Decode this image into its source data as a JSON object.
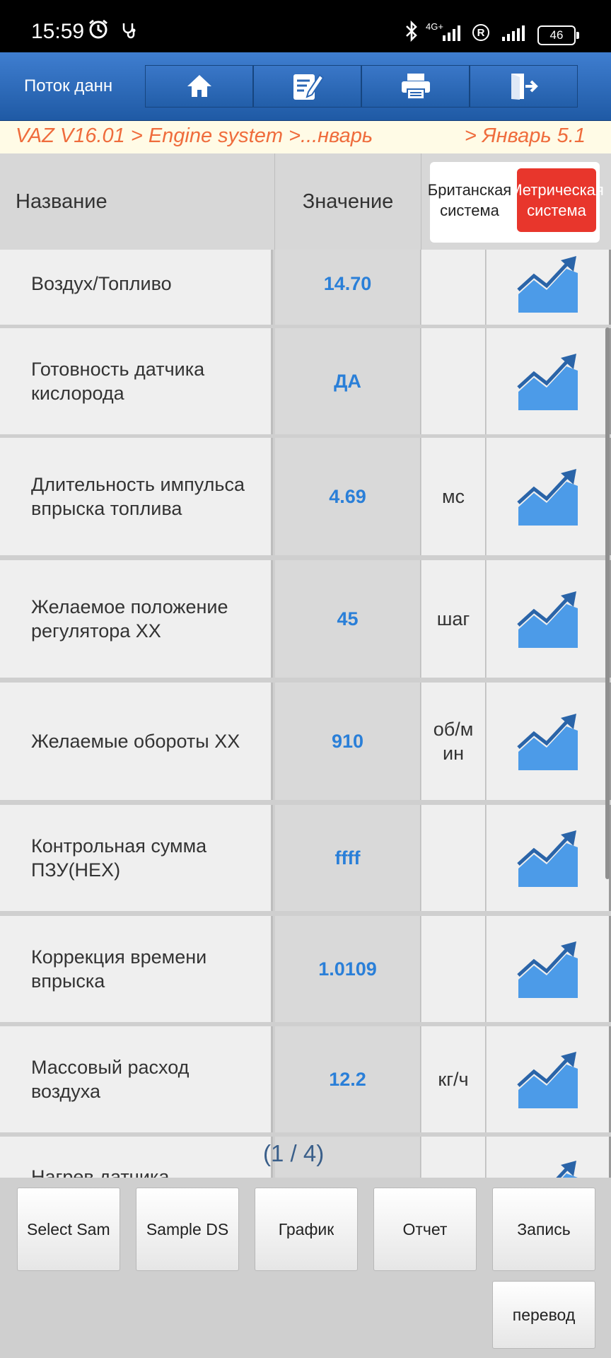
{
  "status_bar": {
    "time": "15:59",
    "network": "4G+",
    "roaming_mark": "R",
    "battery": "46",
    "icons": [
      "alarm-icon",
      "stethoscope-icon",
      "bluetooth-icon",
      "signal-icon",
      "battery-icon"
    ]
  },
  "toolbar": {
    "title": "Поток данн",
    "buttons": [
      "home-icon",
      "edit-icon",
      "print-icon",
      "exit-icon"
    ]
  },
  "breadcrumb": {
    "path": "VAZ V16.01 > Engine system >...нварь",
    "right": "> Январь  5.1"
  },
  "table": {
    "headers": {
      "name": "Название",
      "value": "Значение"
    },
    "unit_toggle": {
      "british": "Британская система",
      "metric": "Метрическая система"
    },
    "rows": [
      {
        "name": "Воздух/Топливо",
        "value": "14.70",
        "unit": ""
      },
      {
        "name": "Готовность датчика кислорода",
        "value": "ДА",
        "unit": ""
      },
      {
        "name": "Длительность импульса впрыска топлива",
        "value": "4.69",
        "unit": "мс"
      },
      {
        "name": "Желаемое положение регулятора ХХ",
        "value": "45",
        "unit": "шаг"
      },
      {
        "name": "Желаемые обороты ХХ",
        "value": "910",
        "unit": "об/мин"
      },
      {
        "name": "Контрольная сумма ПЗУ(HEX)",
        "value": "ffff",
        "unit": ""
      },
      {
        "name": "Коррекция времени впрыска",
        "value": "1.0109",
        "unit": ""
      },
      {
        "name": "Массовый расход воздуха",
        "value": "12.2",
        "unit": "кг/ч"
      },
      {
        "name": "Нагрев датчика",
        "value": "",
        "unit": ""
      }
    ],
    "page_indicator": "(1 / 4)"
  },
  "bottom_buttons": {
    "select_sample": "Select Sample",
    "sample_ds": "Sample DS",
    "graph": "График",
    "report": "Отчет",
    "record": "Запись",
    "translate": "перевод"
  },
  "colors": {
    "toolbar": "#2a66b4",
    "breadcrumb_text": "#ef6c3c",
    "value_text": "#2a7fd8",
    "metric_active": "#e8362c",
    "graph_icon": "#4c9be8"
  }
}
